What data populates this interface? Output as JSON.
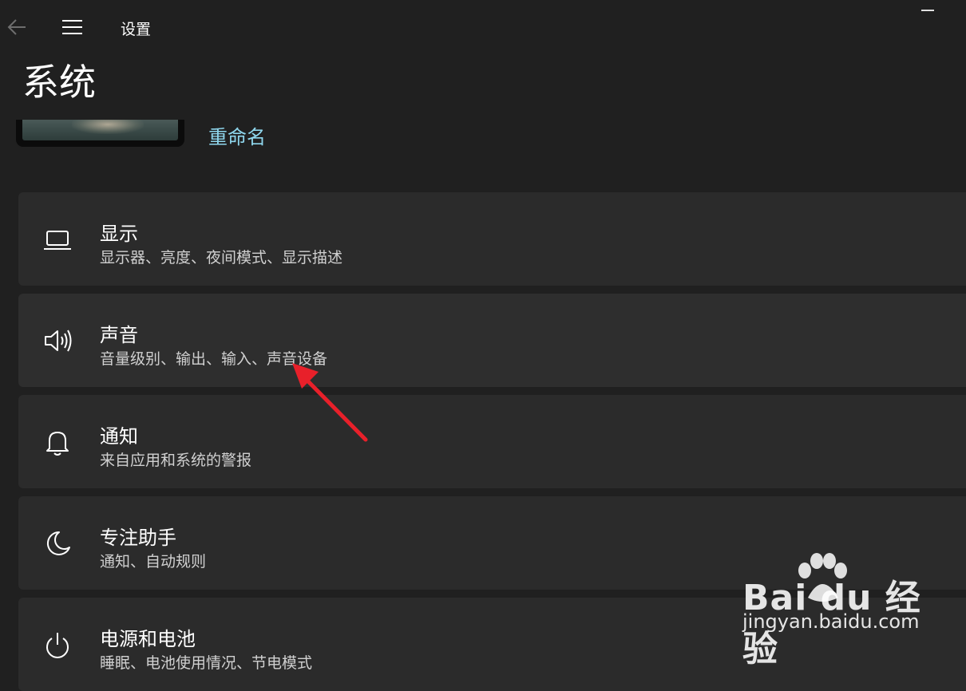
{
  "app": {
    "title": "设置"
  },
  "page": {
    "title": "系统"
  },
  "device": {
    "rename_label": "重命名"
  },
  "settings": [
    {
      "title": "显示",
      "desc": "显示器、亮度、夜间模式、显示描述",
      "icon": "laptop-icon"
    },
    {
      "title": "声音",
      "desc": "音量级别、输出、输入、声音设备",
      "icon": "speaker-icon"
    },
    {
      "title": "通知",
      "desc": "来自应用和系统的警报",
      "icon": "bell-icon"
    },
    {
      "title": "专注助手",
      "desc": "通知、自动规则",
      "icon": "moon-icon"
    },
    {
      "title": "电源和电池",
      "desc": "睡眠、电池使用情况、节电模式",
      "icon": "power-icon"
    }
  ],
  "watermark": {
    "logo": "Bai du 经验",
    "url": "jingyan.baidu.com"
  },
  "colors": {
    "background": "#202020",
    "card": "#2b2b2b",
    "link": "#8fd7ee",
    "arrow": "#e8202a"
  }
}
